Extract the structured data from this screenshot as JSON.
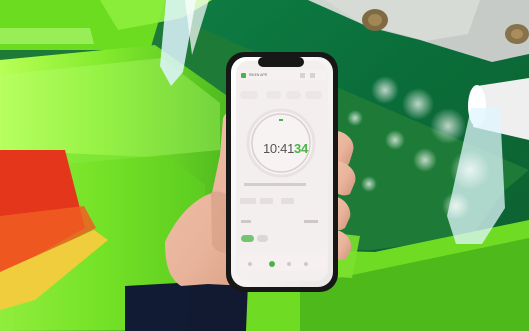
{
  "photo": {
    "scene": "hand holding a smartphone above green tank with flowing water"
  },
  "phone_screen": {
    "header_title": "RIKEN APR",
    "clock": {
      "hours_minutes": "10:41",
      "seconds": "34"
    },
    "colors": {
      "accent": "#49b548",
      "screen_bg": "#f4efef"
    },
    "icons": [
      "app-logo-icon",
      "play-icon",
      "home-icon"
    ]
  }
}
